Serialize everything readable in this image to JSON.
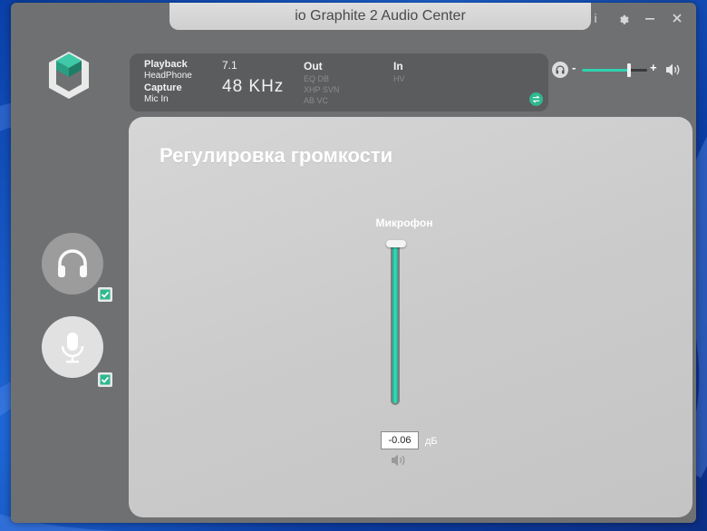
{
  "window": {
    "title": "io Graphite 2 Audio Center"
  },
  "controls": {
    "info_label": "i",
    "settings_icon": "gear-icon",
    "minimize_icon": "minimize-icon",
    "close_icon": "close-icon"
  },
  "info": {
    "playback_label": "Playback",
    "playback_device": "HeadPhone",
    "capture_label": "Capture",
    "capture_device": "Mic In",
    "channels": "7.1",
    "sample_rate": "48 KHz",
    "out_label": "Out",
    "out_effects_row1": "EQ   DB",
    "out_effects_row2": "XHP  SVN",
    "out_effects_row3": "AB   VC",
    "in_label": "In",
    "in_effects_row1": "HV"
  },
  "volume": {
    "minus": "-",
    "plus": "+",
    "level": 0.72
  },
  "devices": {
    "headphone_enabled": true,
    "mic_enabled": true
  },
  "content": {
    "title": "Регулировка громкости",
    "fader_label": "Микрофон",
    "fader_level": 0.98,
    "db_value": "-0.06",
    "db_unit": "дБ"
  },
  "colors": {
    "accent": "#2fd3b0",
    "window_bg": "#6f7072",
    "panel_bg": "#5b5c5e"
  }
}
